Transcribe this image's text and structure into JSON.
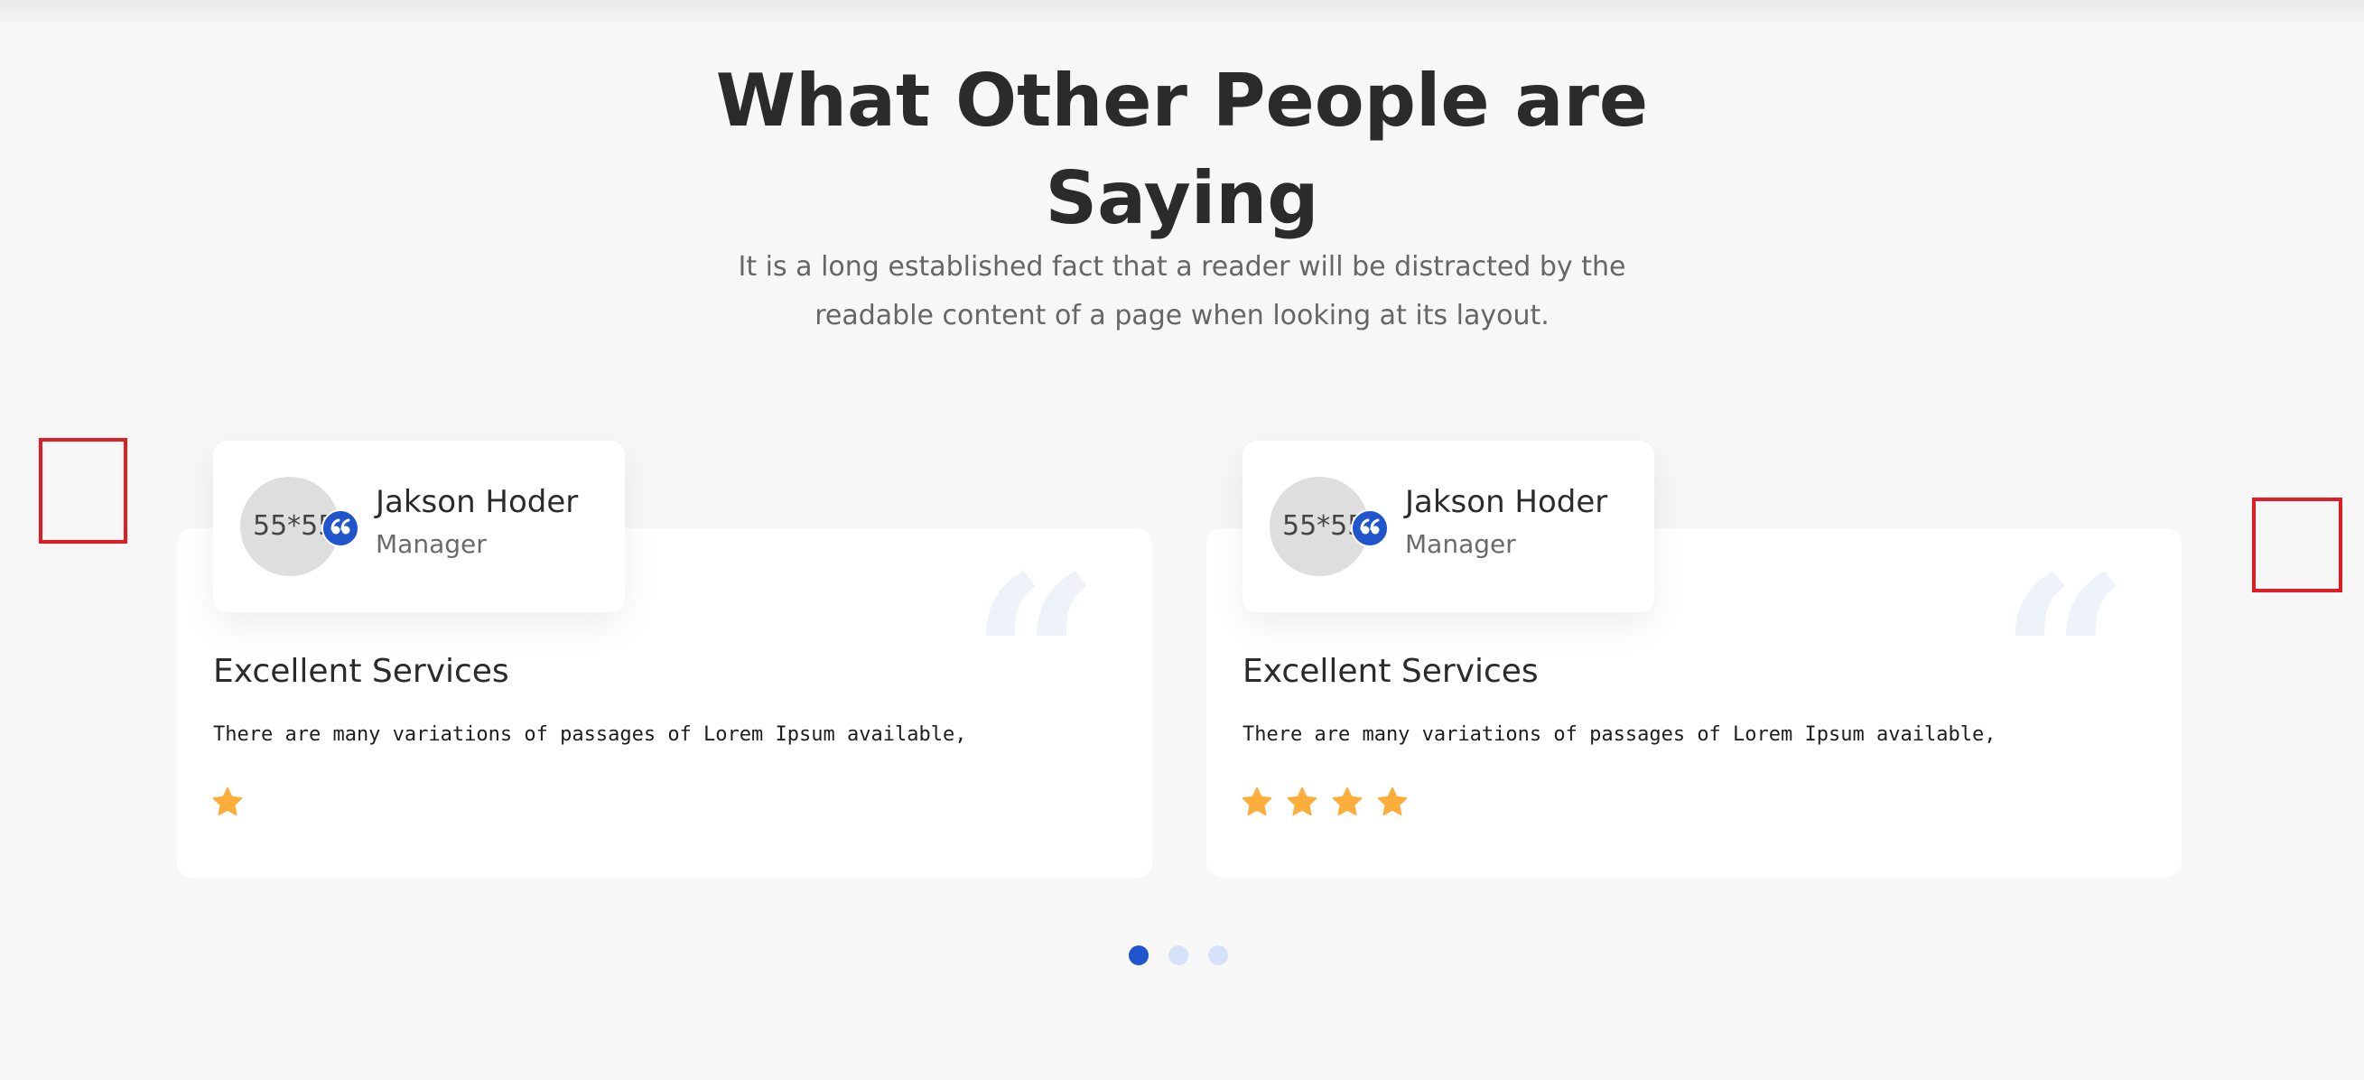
{
  "section": {
    "title_line1": "What Other People are",
    "title_line2": "Saying",
    "subtitle": "It is a long established fact that a reader will be distracted by the readable content of a page when looking at its layout."
  },
  "colors": {
    "background": "#f7f7f7",
    "accent": "#2155cd",
    "star": "#fdad3a",
    "nav_outline": "#e01d24",
    "dot_inactive": "#d6e2f7"
  },
  "testimonials": [
    {
      "avatar_text": "55*55",
      "name": "Jakson Hoder",
      "role": "Manager",
      "title": "Excellent Services",
      "text": "There are many variations of passages of Lorem Ipsum available,",
      "rating": 1,
      "quote_icon": "quote-icon"
    },
    {
      "avatar_text": "55*55",
      "name": "Jakson Hoder",
      "role": "Manager",
      "title": "Excellent Services",
      "text": "There are many variations of passages of Lorem Ipsum available,",
      "rating": 4,
      "quote_icon": "quote-icon"
    }
  ],
  "carousel": {
    "pages": 3,
    "active_page": 1
  }
}
